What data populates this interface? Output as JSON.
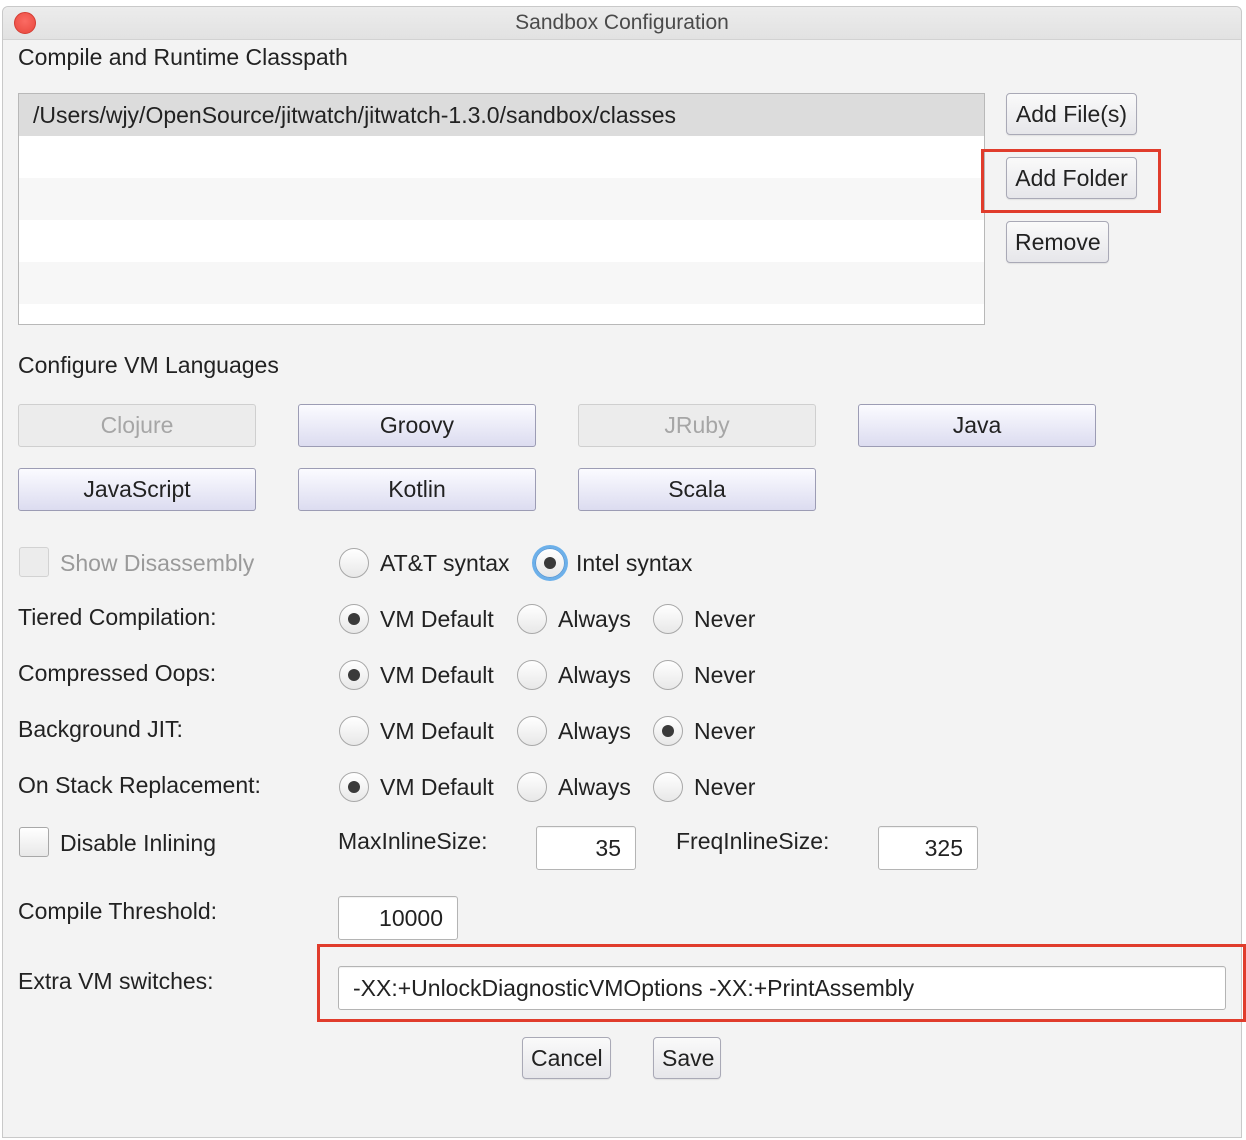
{
  "window": {
    "title": "Sandbox Configuration"
  },
  "classpath": {
    "heading": "Compile and Runtime Classpath",
    "items": [
      "/Users/wjy/OpenSource/jitwatch/jitwatch-1.3.0/sandbox/classes",
      "",
      "",
      "",
      ""
    ],
    "add_files_label": "Add File(s)",
    "add_folder_label": "Add Folder",
    "remove_label": "Remove"
  },
  "languages": {
    "heading": "Configure VM Languages",
    "buttons": [
      "Clojure",
      "Groovy",
      "JRuby",
      "Java",
      "JavaScript",
      "Kotlin",
      "Scala"
    ],
    "disabled": [
      "Clojure",
      "JRuby"
    ]
  },
  "disassembly": {
    "label": "Show Disassembly",
    "enabled": false,
    "att_label": "AT&T syntax",
    "intel_label": "Intel syntax",
    "selected": "Intel syntax"
  },
  "options": {
    "choices": [
      "VM Default",
      "Always",
      "Never"
    ],
    "rows": [
      {
        "label": "Tiered Compilation:",
        "selected": "VM Default"
      },
      {
        "label": "Compressed Oops:",
        "selected": "VM Default"
      },
      {
        "label": "Background JIT:",
        "selected": "Never"
      },
      {
        "label": "On Stack Replacement:",
        "selected": "VM Default"
      }
    ]
  },
  "inlining": {
    "disable_label": "Disable Inlining",
    "disabled": false,
    "max_label": "MaxInlineSize:",
    "max_value": "35",
    "freq_label": "FreqInlineSize:",
    "freq_value": "325"
  },
  "threshold": {
    "label": "Compile Threshold:",
    "value": "10000"
  },
  "extra": {
    "label": "Extra VM switches:",
    "value": "-XX:+UnlockDiagnosticVMOptions -XX:+PrintAssembly"
  },
  "footer": {
    "cancel_label": "Cancel",
    "save_label": "Save"
  },
  "colors": {
    "highlight": "#e03c2c",
    "focus_ring": "#6cb0ea"
  }
}
